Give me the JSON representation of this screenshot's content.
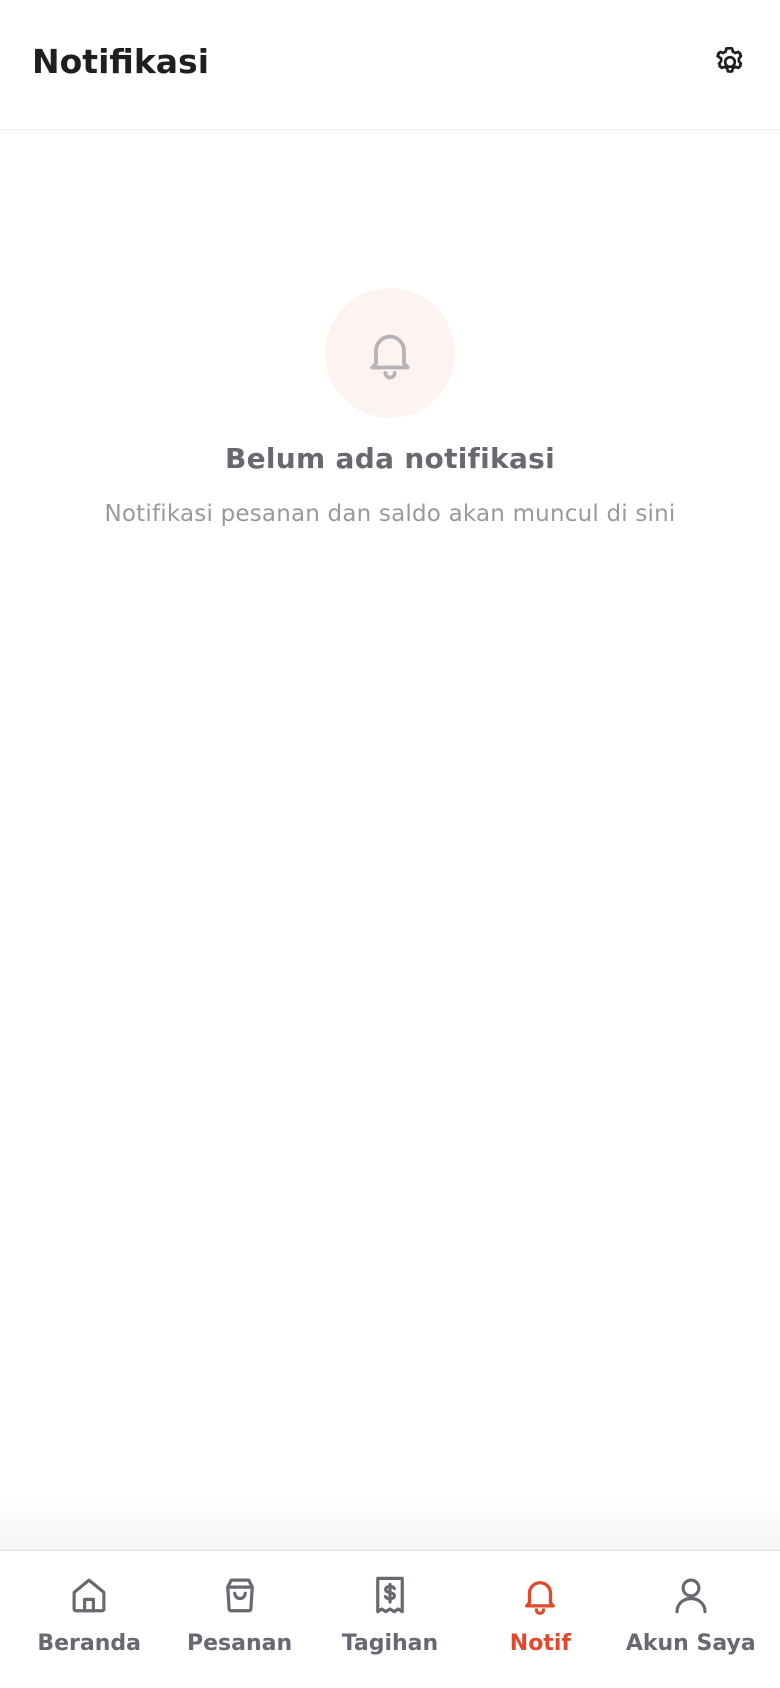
{
  "header": {
    "title": "Notifikasi",
    "settings_icon": "gear-icon"
  },
  "empty_state": {
    "icon": "bell-icon",
    "title": "Belum ada notifikasi",
    "subtitle": "Notifikasi pesanan dan saldo akan muncul di sini"
  },
  "bottom_nav": {
    "active_color": "#e0492c",
    "inactive_color": "#6b6670",
    "items": [
      {
        "label": "Beranda",
        "icon": "home-icon",
        "active": false
      },
      {
        "label": "Pesanan",
        "icon": "shopping-bag-icon",
        "active": false
      },
      {
        "label": "Tagihan",
        "icon": "receipt-icon",
        "active": false
      },
      {
        "label": "Notif",
        "icon": "bell-icon",
        "active": true
      },
      {
        "label": "Akun Saya",
        "icon": "user-icon",
        "active": false
      }
    ]
  }
}
